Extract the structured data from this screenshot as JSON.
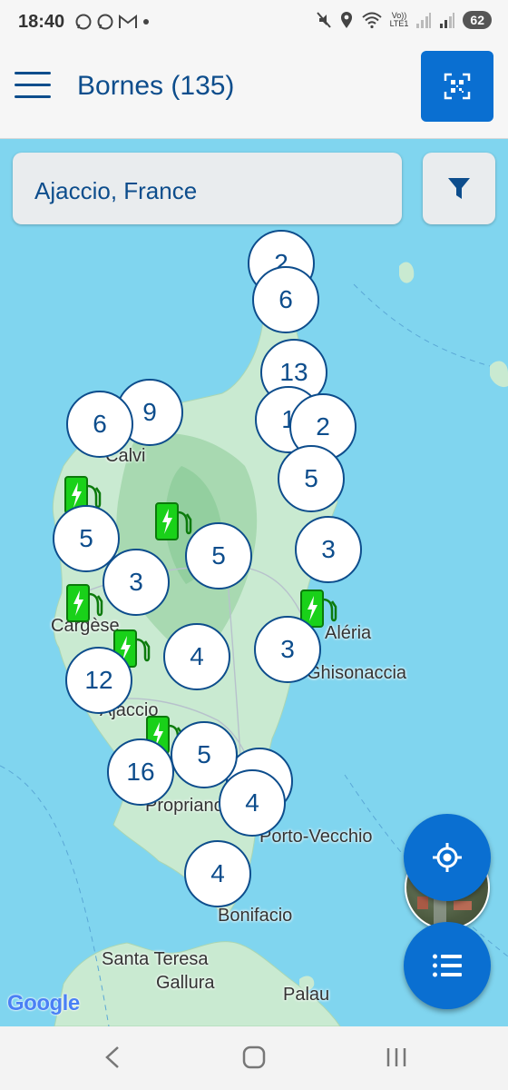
{
  "status_bar": {
    "time": "18:40",
    "left_icons": [
      "whatsapp-icon",
      "whatsapp-icon",
      "gmail-icon",
      "dot-icon"
    ],
    "right_icons": [
      "mute-icon",
      "location-icon",
      "wifi-icon",
      "volte-icon",
      "signal-icon",
      "signal-icon"
    ],
    "volte_label_top": "Vo))",
    "volte_label_bottom": "LTE1",
    "battery": "62"
  },
  "header": {
    "title": "Bornes (135)",
    "menu_icon": "hamburger-menu-icon",
    "qr_icon": "qr-scan-icon",
    "accent_color": "#0a6fd1",
    "text_color": "#0d4d8c"
  },
  "search": {
    "value": "Ajaccio, France",
    "filter_icon": "filter-icon"
  },
  "map": {
    "clusters": [
      {
        "label": "2"
      },
      {
        "label": "6"
      },
      {
        "label": "13"
      },
      {
        "label": "1"
      },
      {
        "label": "2"
      },
      {
        "label": "9"
      },
      {
        "label": "6"
      },
      {
        "label": "5"
      },
      {
        "label": "5"
      },
      {
        "label": "3"
      },
      {
        "label": "3"
      },
      {
        "label": "5"
      },
      {
        "label": "4"
      },
      {
        "label": "3"
      },
      {
        "label": "12"
      },
      {
        "label": "5"
      },
      {
        "label": "16"
      },
      {
        "label": "4"
      },
      {
        "label": "5"
      },
      {
        "label": "4"
      }
    ],
    "place_labels": [
      "Calvi",
      "Cargèse",
      "Aléria",
      "Ghisonaccia",
      "Ajaccio",
      "Propriano",
      "Porto-Vecchio",
      "Bonifacio",
      "Santa Teresa",
      "Gallura",
      "Palau"
    ],
    "charger_icon": "charging-station-icon",
    "charger_color": "#19d119",
    "attribution": "Google"
  },
  "fabs": {
    "satellite": "satellite-view-icon",
    "locate": "my-location-icon",
    "list": "list-view-icon"
  },
  "nav_bar": [
    "back-icon",
    "home-icon",
    "recents-icon"
  ]
}
